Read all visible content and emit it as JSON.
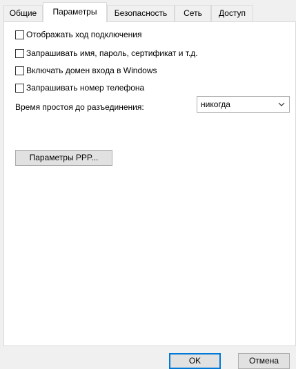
{
  "tabs": [
    {
      "label": "Общие",
      "active": false
    },
    {
      "label": "Параметры",
      "active": true
    },
    {
      "label": "Безопасность",
      "active": false
    },
    {
      "label": "Сеть",
      "active": false
    },
    {
      "label": "Доступ",
      "active": false
    }
  ],
  "options": [
    {
      "label": "Отображать ход подключения",
      "checked": false
    },
    {
      "label": "Запрашивать имя, пароль, сертификат и т.д.",
      "checked": false
    },
    {
      "label": "Включать домен входа в Windows",
      "checked": false
    },
    {
      "label": "Запрашивать номер телефона",
      "checked": false
    }
  ],
  "idle": {
    "label": "Время простоя до разъединения:",
    "value": "никогда"
  },
  "ppp_button": "Параметры PPP...",
  "footer": {
    "ok": "OK",
    "cancel": "Отмена"
  }
}
